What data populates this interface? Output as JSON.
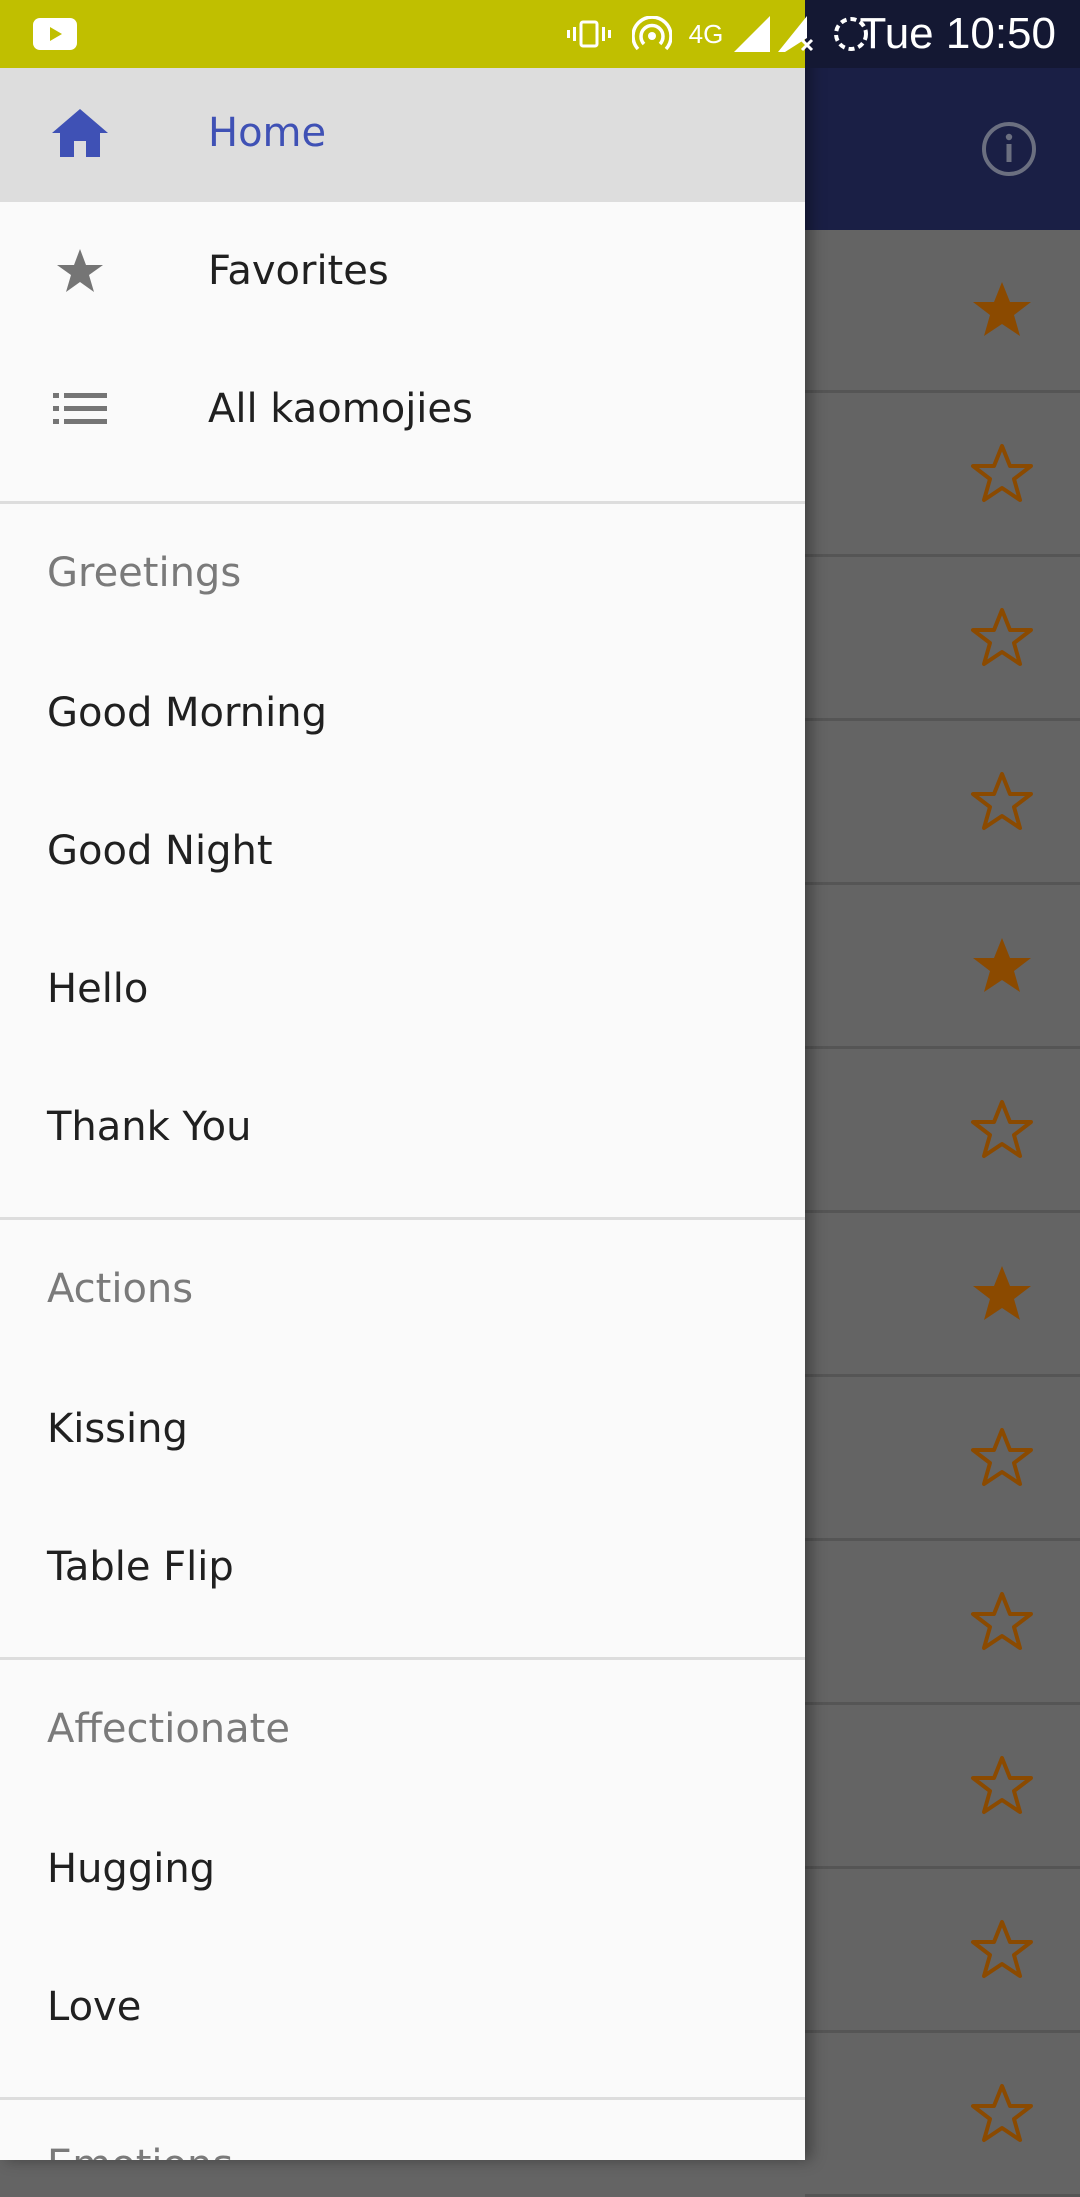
{
  "status_bar": {
    "time": "Tue 10:50",
    "network": "4G",
    "icons": [
      "youtube-icon",
      "vibrate-icon",
      "hotspot-icon",
      "signal-icon",
      "signal-no-data-icon",
      "battery-charging-icon"
    ],
    "colors": {
      "left_bg": "#c0bf00",
      "right_bg": "#141833",
      "icon": "#ffffff"
    }
  },
  "drawer": {
    "nav": [
      {
        "label": "Home",
        "icon": "home-icon",
        "active": true
      },
      {
        "label": "Favorites",
        "icon": "star-icon",
        "active": false
      },
      {
        "label": "All kaomojies",
        "icon": "list-icon",
        "active": false
      }
    ],
    "sections": [
      {
        "title": "Greetings",
        "items": [
          "Good Morning",
          "Good Night",
          "Hello",
          "Thank You"
        ]
      },
      {
        "title": "Actions",
        "items": [
          "Kissing",
          "Table Flip"
        ]
      },
      {
        "title": "Affectionate",
        "items": [
          "Hugging",
          "Love"
        ]
      },
      {
        "title": "Emotions",
        "items": []
      }
    ],
    "colors": {
      "active_text": "#3f51b5",
      "active_bg": "#dddddd",
      "text": "#202020",
      "section_text": "#7a7a7a"
    }
  },
  "app_behind": {
    "info_icon": "info-icon",
    "list_stars": [
      true,
      false,
      false,
      false,
      true,
      false,
      true,
      false,
      false,
      false,
      false,
      false
    ],
    "colors": {
      "appbar": "#1a1f45",
      "star": "#8b4a00"
    }
  }
}
